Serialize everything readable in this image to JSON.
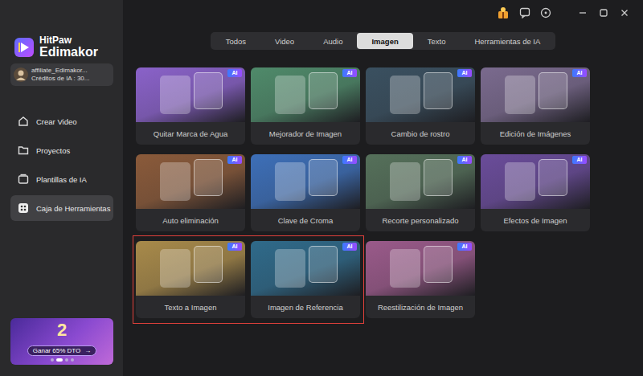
{
  "app": {
    "brand_top": "HitPaw",
    "brand_bottom": "Edimakor"
  },
  "user": {
    "name": "affiliate_Edimakor...",
    "credits": "Créditos de IA : 30..."
  },
  "nav": [
    {
      "label": "Crear Video",
      "selected": false
    },
    {
      "label": "Proyectos",
      "selected": false
    },
    {
      "label": "Plantillas de IA",
      "selected": false
    },
    {
      "label": "Caja de Herramientas",
      "selected": true
    }
  ],
  "promo": {
    "badge": "2",
    "button": "Ganar 65% DTO",
    "arrow": "→",
    "dots": [
      {
        "selected": false
      },
      {
        "selected": true
      },
      {
        "selected": false
      },
      {
        "selected": false
      }
    ]
  },
  "tabs": [
    {
      "label": "Todos",
      "selected": false
    },
    {
      "label": "Video",
      "selected": false
    },
    {
      "label": "Audio",
      "selected": false
    },
    {
      "label": "Imagen",
      "selected": true
    },
    {
      "label": "Texto",
      "selected": false
    },
    {
      "label": "Herramientas de IA",
      "selected": false
    }
  ],
  "tools": [
    {
      "label": "Quitar Marca de Agua",
      "badge": "AI",
      "color": "#8a62c9"
    },
    {
      "label": "Mejorador de Imagen",
      "badge": "AI",
      "color": "#4f8a6a"
    },
    {
      "label": "Cambio de rostro",
      "badge": "AI",
      "color": "#3a5060"
    },
    {
      "label": "Edición de Imágenes",
      "badge": "AI",
      "color": "#7a6a8e"
    },
    {
      "label": "Auto eliminación",
      "badge": "AI",
      "color": "#8a5a3a"
    },
    {
      "label": "Clave de Croma",
      "badge": "AI",
      "color": "#3d6fb8"
    },
    {
      "label": "Recorte personalizado",
      "badge": "AI",
      "color": "#55705a"
    },
    {
      "label": "Efectos de Imagen",
      "badge": "AI",
      "color": "#6a4c9a"
    },
    {
      "label": "Texto a Imagen",
      "badge": "AI",
      "color": "#a88a4a"
    },
    {
      "label": "Imagen de Referencia",
      "badge": "AI",
      "color": "#2f6a8a"
    },
    {
      "label": "Reestilización de Imagen",
      "badge": "AI",
      "color": "#9a5a8a"
    }
  ],
  "annotation": {
    "kind": "highlight-box",
    "color": "#e0403a",
    "covers": [
      "Texto a Imagen",
      "Imagen de Referencia"
    ]
  }
}
